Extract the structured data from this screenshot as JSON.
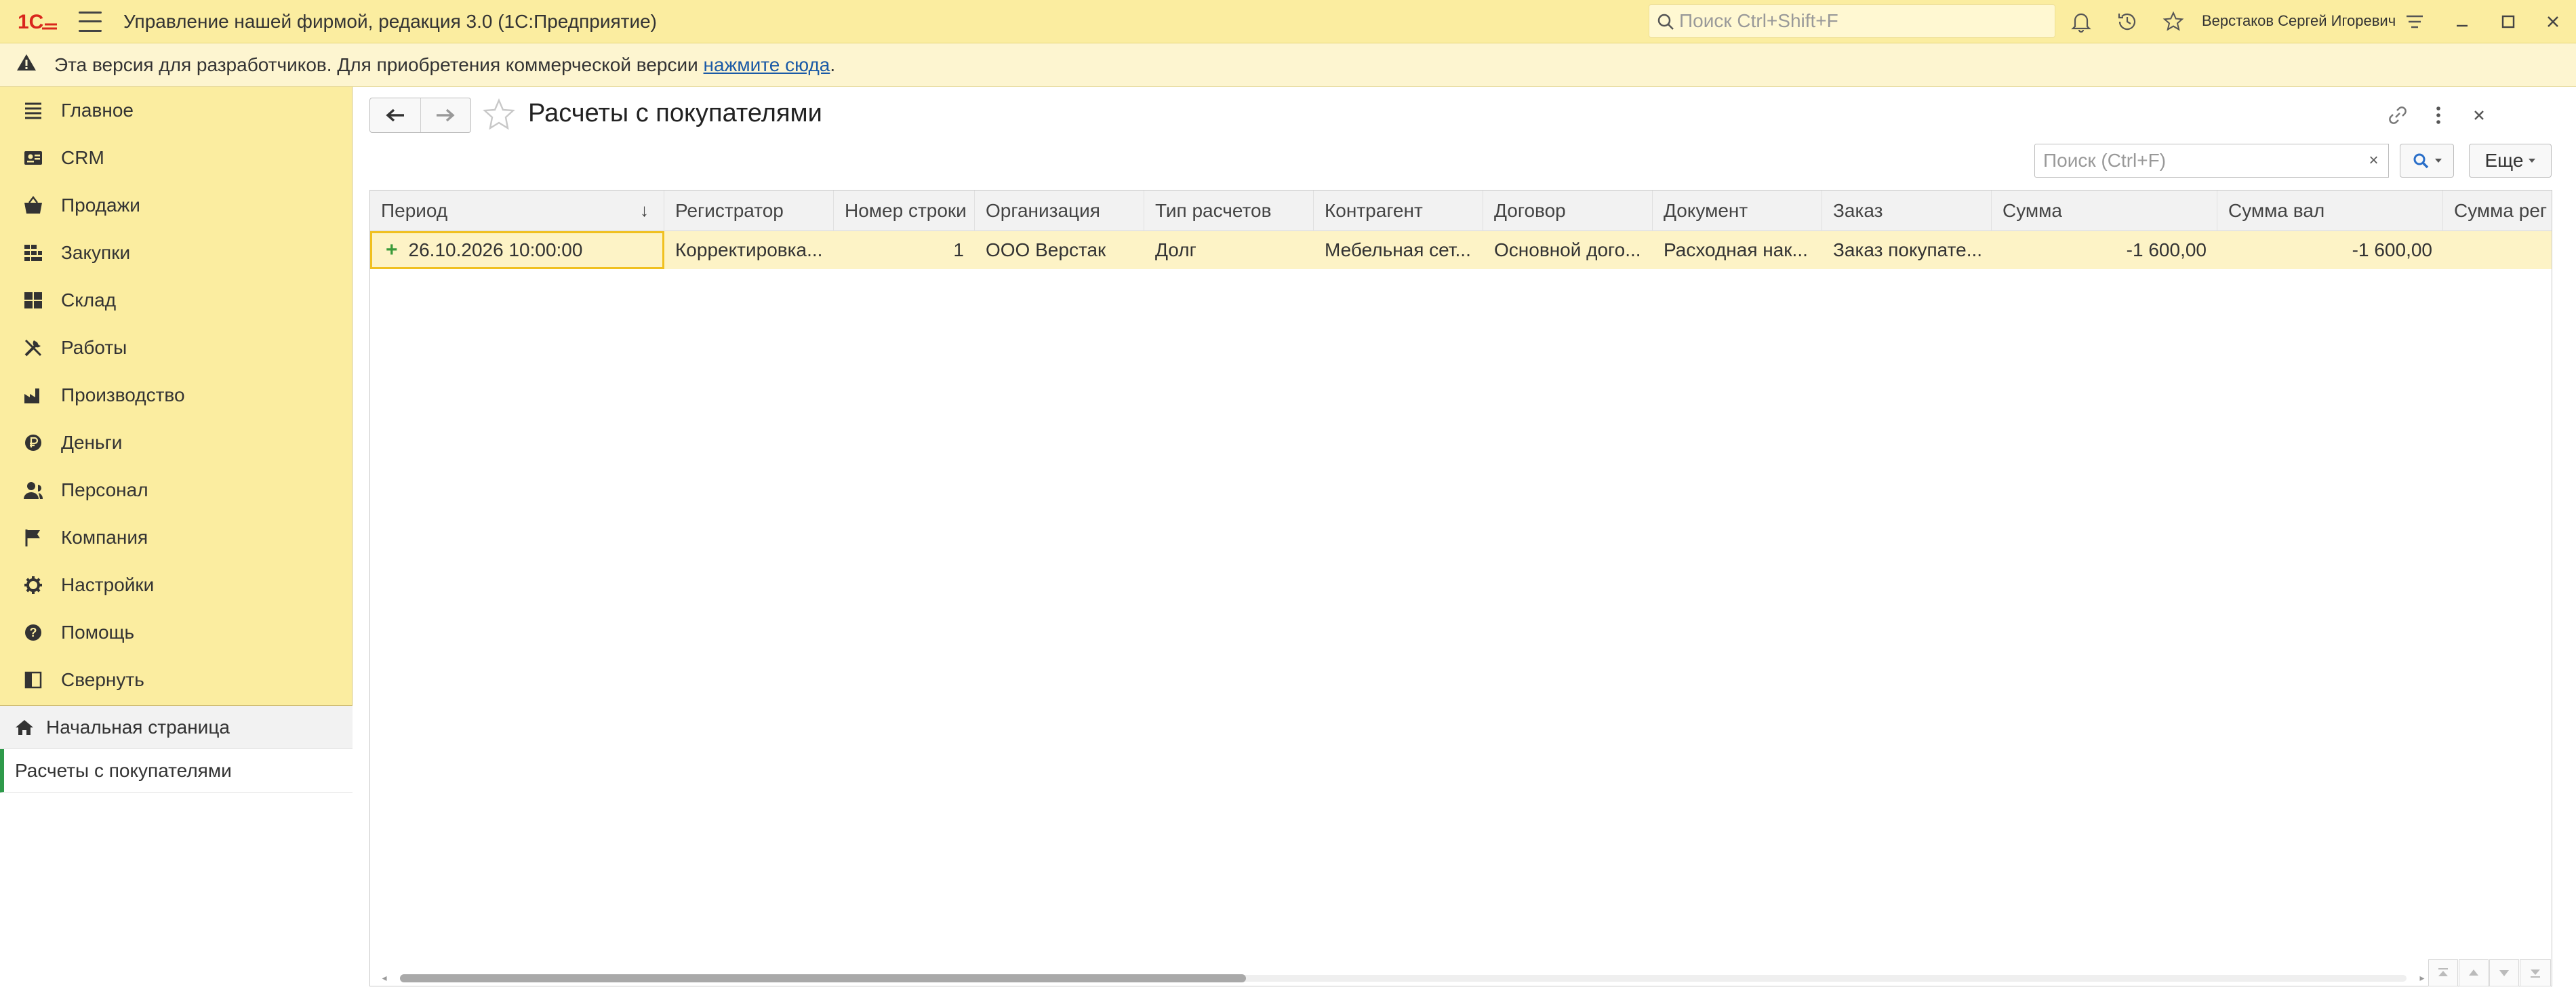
{
  "titlebar": {
    "app_title": "Управление нашей фирмой, редакция 3.0  (1С:Предприятие)",
    "search_placeholder": "Поиск Ctrl+Shift+F",
    "user_name": "Верстаков Сергей Игоревич"
  },
  "infobar": {
    "message": "Эта версия для разработчиков. Для приобретения коммерческой версии ",
    "link": "нажмите сюда",
    "suffix": "."
  },
  "sidebar": {
    "items": [
      {
        "label": "Главное",
        "icon": "list-icon"
      },
      {
        "label": "CRM",
        "icon": "crm-icon"
      },
      {
        "label": "Продажи",
        "icon": "basket-icon"
      },
      {
        "label": "Закупки",
        "icon": "purchases-icon"
      },
      {
        "label": "Склад",
        "icon": "warehouse-icon"
      },
      {
        "label": "Работы",
        "icon": "tools-icon"
      },
      {
        "label": "Производство",
        "icon": "factory-icon"
      },
      {
        "label": "Деньги",
        "icon": "money-icon"
      },
      {
        "label": "Персонал",
        "icon": "person-icon"
      },
      {
        "label": "Компания",
        "icon": "flag-icon"
      },
      {
        "label": "Настройки",
        "icon": "gear-icon"
      },
      {
        "label": "Помощь",
        "icon": "help-icon"
      },
      {
        "label": "Свернуть",
        "icon": "collapse-icon"
      }
    ],
    "open_windows": {
      "home": "Начальная страница",
      "current": "Расчеты с покупателями"
    }
  },
  "form": {
    "title": "Расчеты с покупателями",
    "search_placeholder": "Поиск (Ctrl+F)",
    "clear_label": "×",
    "more_label": "Еще"
  },
  "table": {
    "columns": [
      "Период",
      "Регистратор",
      "Номер строки",
      "Организация",
      "Тип расчетов",
      "Контрагент",
      "Договор",
      "Документ",
      "Заказ",
      "Сумма",
      "Сумма вал",
      "Сумма рег"
    ],
    "rows": [
      [
        "26.10.2026 10:00:00",
        "Корректировка...",
        "1",
        "ООО Верстак",
        "Долг",
        "Мебельная сет...",
        "Основной дого...",
        "Расходная нак...",
        "Заказ покупате...",
        "-1 600,00",
        "-1 600,00",
        ""
      ]
    ]
  },
  "colors": {
    "titlebar_bg": "#fbeda0",
    "sidebar_bg": "#fbeda0",
    "selected_row_bg": "#fdf3c6",
    "focus_border": "#f0c020",
    "logo_red": "#d9261c",
    "active_marker": "#2e9a4a"
  }
}
